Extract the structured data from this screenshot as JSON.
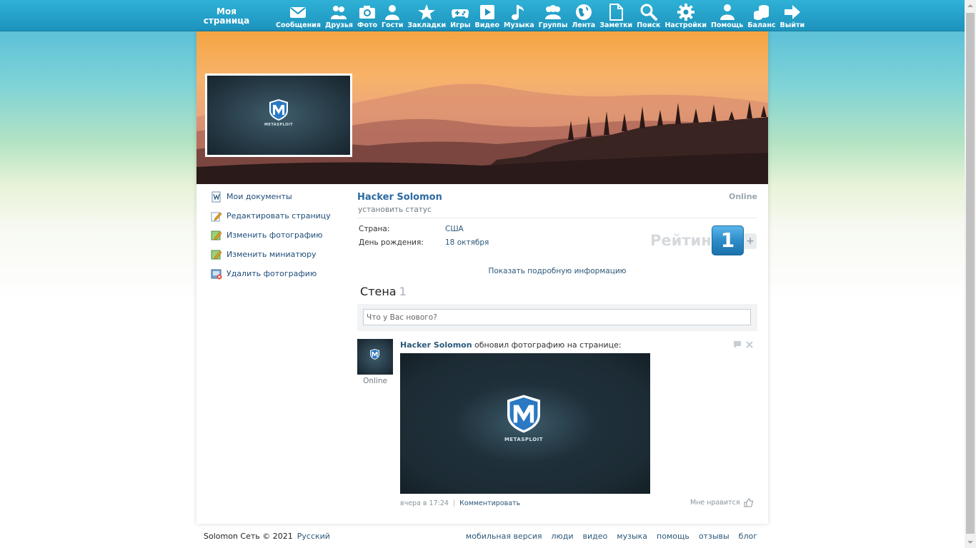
{
  "brand": {
    "line1": "Моя",
    "line2": "страница"
  },
  "nav": [
    {
      "label": "Сообщения",
      "icon": "envelope-icon"
    },
    {
      "label": "Друзья",
      "icon": "friends-icon"
    },
    {
      "label": "Фото",
      "icon": "camera-icon"
    },
    {
      "label": "Гости",
      "icon": "guest-icon"
    },
    {
      "label": "Закладки",
      "icon": "star-icon"
    },
    {
      "label": "Игры",
      "icon": "gamepad-icon"
    },
    {
      "label": "Видео",
      "icon": "play-icon"
    },
    {
      "label": "Музыка",
      "icon": "music-icon"
    },
    {
      "label": "Группы",
      "icon": "groups-icon"
    },
    {
      "label": "Лента",
      "icon": "globe-icon"
    },
    {
      "label": "Заметки",
      "icon": "note-icon"
    },
    {
      "label": "Поиск",
      "icon": "search-icon"
    },
    {
      "label": "Настройки",
      "icon": "gear-icon"
    },
    {
      "label": "Помощь",
      "icon": "help-icon"
    },
    {
      "label": "Баланс",
      "icon": "coins-icon"
    },
    {
      "label": "Выйти",
      "icon": "arrow-right-icon"
    }
  ],
  "left_menu": [
    {
      "label": "Мои документы",
      "icon": "document-icon"
    },
    {
      "label": "Редактировать страницу",
      "icon": "edit-icon"
    },
    {
      "label": "Изменить фотографию",
      "icon": "edit-photo-icon"
    },
    {
      "label": "Изменить миниатюру",
      "icon": "edit-thumbnail-icon"
    },
    {
      "label": "Удалить фотографию",
      "icon": "delete-photo-icon"
    }
  ],
  "profile": {
    "name": "Hacker Solomon",
    "online": "Online",
    "status_link": "установить статус",
    "fields": [
      {
        "label": "Страна:",
        "value": "США"
      },
      {
        "label": "День рождения:",
        "value": "18 октября"
      }
    ],
    "rating_label": "Рейтинг",
    "rating_value": "1",
    "rating_plus": "+",
    "show_more": "Показать подробную информацию"
  },
  "avatar_logo_text": "METASPLOIT",
  "wall": {
    "title": "Стена",
    "count": "1",
    "placeholder": "Что у Вас нового?"
  },
  "post": {
    "author": "Hacker Solomon",
    "action": " обновил фотографию на странице:",
    "online": "Online",
    "time": "вчера в 17:24",
    "separator": "|",
    "comment": "Комментировать",
    "like": "Мне нравится"
  },
  "footer": {
    "copyright": "Solomon Сеть © 2021",
    "language": "Русский",
    "links": [
      "мобильная версия",
      "люди",
      "видео",
      "музыка",
      "помощь",
      "отзывы",
      "блог"
    ]
  },
  "colors": {
    "topbar": "#1d93bd",
    "link": "#2b587a",
    "rating": "#2e8cc8"
  }
}
